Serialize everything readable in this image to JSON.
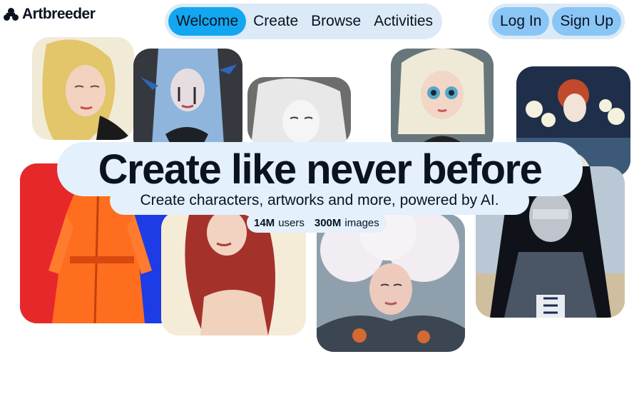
{
  "brand": {
    "name": "Artbreeder",
    "logo_icon": "artbreeder-logo-icon"
  },
  "nav": {
    "items": [
      {
        "label": "Welcome",
        "active": true
      },
      {
        "label": "Create",
        "active": false
      },
      {
        "label": "Browse",
        "active": false
      },
      {
        "label": "Activities",
        "active": false
      }
    ]
  },
  "auth": {
    "login_label": "Log In",
    "signup_label": "Sign Up"
  },
  "hero": {
    "title": "Create like never before",
    "subtitle": "Create characters, artworks and more, powered by AI.",
    "stats": {
      "users_value": "14M",
      "users_label": "users",
      "images_value": "300M",
      "images_label": "images"
    }
  },
  "colors": {
    "accent": "#12a7f0",
    "pill_bg": "#dceaf8",
    "auth_button": "#8ac6f5",
    "hero_pill": "#e4f0fb",
    "text": "#0b1220"
  }
}
